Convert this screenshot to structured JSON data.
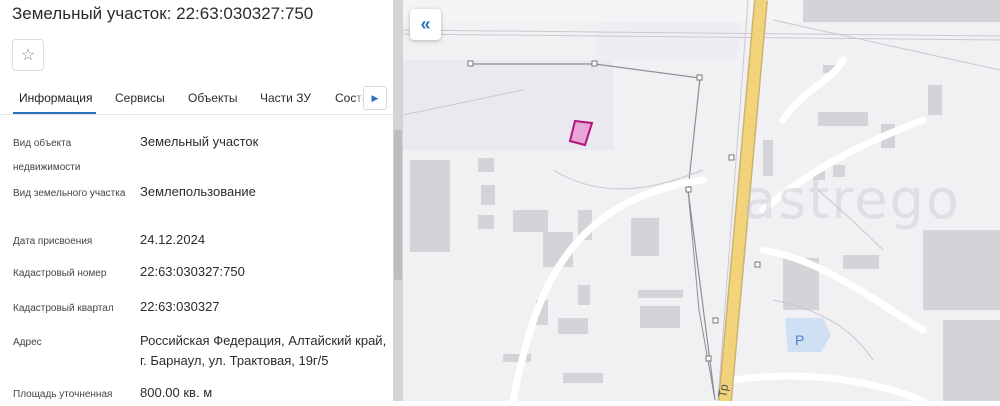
{
  "panel": {
    "title": "Земельный участок: 22:63:030327:750",
    "favorite_icon": "star-outline-icon",
    "tabs": [
      {
        "label": "Информация",
        "active": true
      },
      {
        "label": "Сервисы"
      },
      {
        "label": "Объекты"
      },
      {
        "label": "Части ЗУ"
      },
      {
        "label": "Соста"
      }
    ],
    "tabs_next_icon": "chevron-right-icon"
  },
  "info": {
    "object_type_label": "Вид объекта недвижимости",
    "object_type_value": "Земельный участок",
    "plot_type_label": "Вид земельного участка",
    "plot_type_value": "Землепользование",
    "assign_date_label": "Дата присвоения",
    "assign_date_value": "24.12.2024",
    "cadastral_number_label": "Кадастровый номер",
    "cadastral_number_value": "22:63:030327:750",
    "cadastral_quarter_label": "Кадастровый квартал",
    "cadastral_quarter_value": "22:63:030327",
    "address_label": "Адрес",
    "address_value": "Российская Федерация, Алтайский край, г. Барнаул, ул. Трактовая, 19г/5",
    "area_label": "Площадь уточненная",
    "area_value": "800.00 кв. м"
  },
  "map": {
    "collapse_icon": "double-chevron-left-icon",
    "collapse_glyph": "«",
    "parking_label": "P",
    "road_label": "Тр",
    "plot_highlight_color": "#c8198c",
    "road_color": "#f2d37a",
    "watermark": "astrego"
  }
}
